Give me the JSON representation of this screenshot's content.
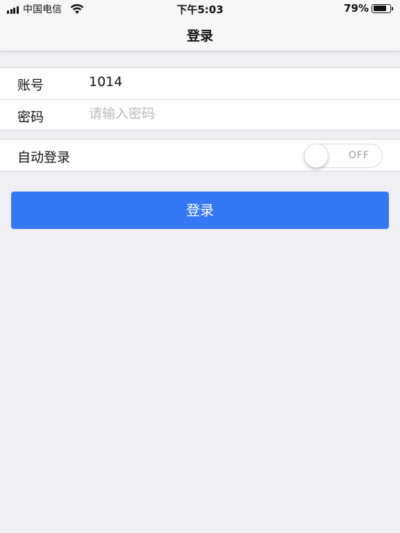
{
  "status_bar": {
    "carrier": "中国电信",
    "time": "下午5:03",
    "battery": "79%",
    "battery_level": 0.79,
    "icons": [
      "signal-icon",
      "wifi-icon",
      "battery-icon"
    ]
  },
  "nav": {
    "title": "登录"
  },
  "form": {
    "account_label": "账号",
    "account_value": "1014",
    "password_label": "密码",
    "password_placeholder": "请输入密码"
  },
  "auto_login": {
    "label": "自动登录",
    "toggle_text": "OFF",
    "enabled": false
  },
  "login_button": {
    "label": "登录",
    "color": "#3478f6"
  }
}
